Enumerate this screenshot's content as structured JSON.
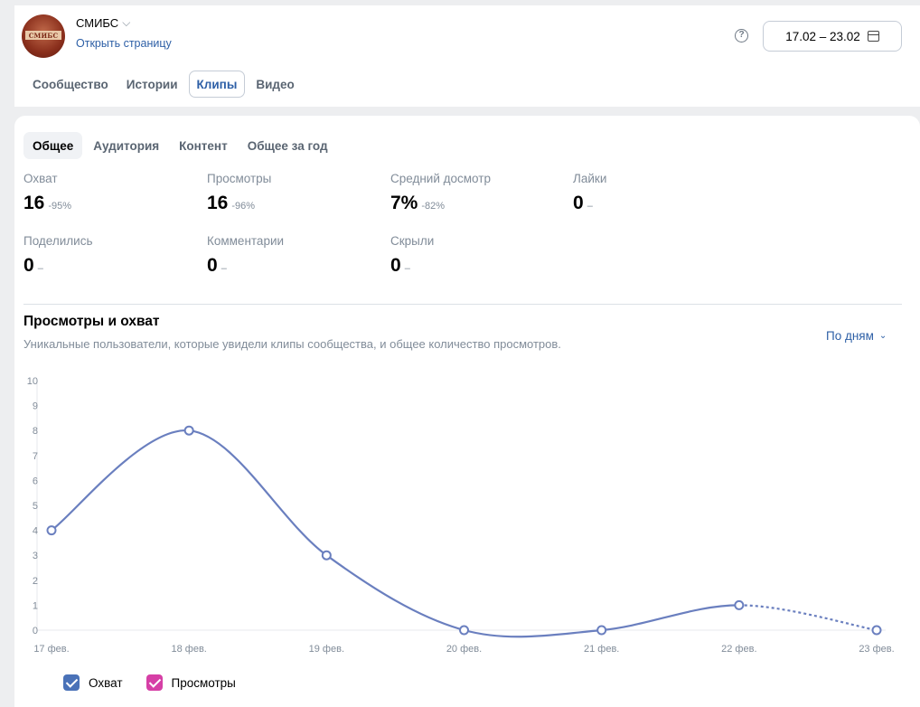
{
  "community": {
    "name": "СМИБС",
    "avatar_text": "СМИБС",
    "open_link": "Открыть страницу"
  },
  "date_range": "17.02 – 23.02",
  "top_tabs": [
    {
      "label": "Сообщество",
      "active": false
    },
    {
      "label": "Истории",
      "active": false
    },
    {
      "label": "Клипы",
      "active": true
    },
    {
      "label": "Видео",
      "active": false
    }
  ],
  "sub_tabs": [
    {
      "label": "Общее",
      "active": true
    },
    {
      "label": "Аудитория",
      "active": false
    },
    {
      "label": "Контент",
      "active": false
    },
    {
      "label": "Общее за год",
      "active": false
    }
  ],
  "metrics": [
    {
      "label": "Охват",
      "value": "16",
      "change": "-95%"
    },
    {
      "label": "Просмотры",
      "value": "16",
      "change": "-96%"
    },
    {
      "label": "Средний досмотр",
      "value": "7%",
      "change": "-82%"
    },
    {
      "label": "Лайки",
      "value": "0",
      "change": "–"
    },
    {
      "label": "Поделились",
      "value": "0",
      "change": "–"
    },
    {
      "label": "Комментарии",
      "value": "0",
      "change": "–"
    },
    {
      "label": "Скрыли",
      "value": "0",
      "change": "–"
    }
  ],
  "chart_section": {
    "title": "Просмотры и охват",
    "subtitle": "Уникальные пользователи, которые увидели клипы сообщества, и общее количество просмотров.",
    "period_label": "По дням"
  },
  "chart_data": {
    "type": "line",
    "categories": [
      "17 фев.",
      "18 фев.",
      "19 фев.",
      "20 фев.",
      "21 фев.",
      "22 фев.",
      "23 фев."
    ],
    "series": [
      {
        "name": "Охват",
        "values": [
          4,
          8,
          3,
          0,
          0,
          1,
          0
        ],
        "color": "#6a7fbf",
        "last_segment_dashed": true
      }
    ],
    "ylim": [
      0,
      10
    ],
    "yticks": [
      0,
      1,
      2,
      3,
      4,
      5,
      6,
      7,
      8,
      9,
      10
    ],
    "legend": [
      {
        "label": "Охват",
        "color": "#4a72b8",
        "checked": true
      },
      {
        "label": "Просмотры",
        "color": "#d63fa6",
        "checked": true
      }
    ]
  }
}
